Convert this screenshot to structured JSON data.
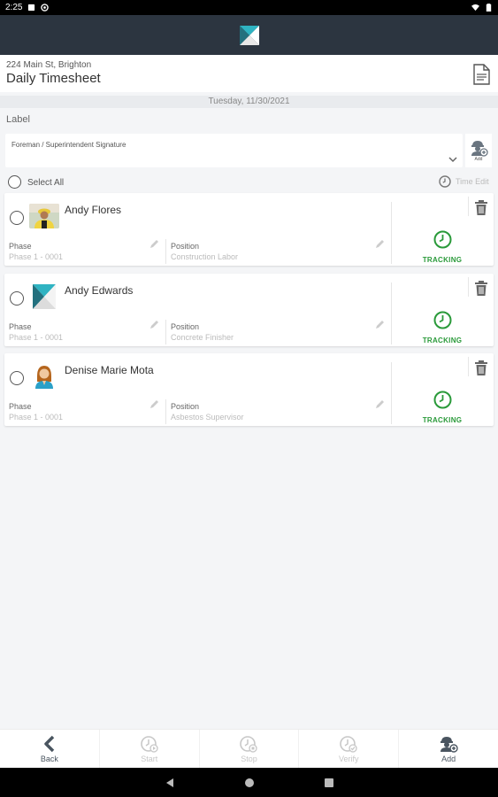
{
  "status_bar": {
    "time": "2:25"
  },
  "header": {
    "address": "224 Main St, Brighton",
    "title": "Daily Timesheet"
  },
  "date": "Tuesday, 11/30/2021",
  "label": "Label",
  "signature": {
    "label": "Foreman / Superintendent Signature",
    "add_label": "Add"
  },
  "select_all": {
    "label": "Select All"
  },
  "time_edit": {
    "label": "Time Edit"
  },
  "employees": [
    {
      "name": "Andy Flores",
      "phase_label": "Phase",
      "phase_value": "Phase 1 - 0001",
      "position_label": "Position",
      "position_value": "Construction Labor",
      "status": "TRACKING"
    },
    {
      "name": "Andy Edwards",
      "phase_label": "Phase",
      "phase_value": "Phase 1 - 0001",
      "position_label": "Position",
      "position_value": "Concrete Finisher",
      "status": "TRACKING"
    },
    {
      "name": "Denise Marie Mota",
      "phase_label": "Phase",
      "phase_value": "Phase 1 - 0001",
      "position_label": "Position",
      "position_value": "Asbestos Supervisor",
      "status": "TRACKING"
    }
  ],
  "bottom_nav": [
    {
      "label": "Back",
      "icon": "back-arrow-icon",
      "enabled": true
    },
    {
      "label": "Start",
      "icon": "clock-start-icon",
      "enabled": false
    },
    {
      "label": "Stop",
      "icon": "clock-stop-icon",
      "enabled": false
    },
    {
      "label": "Verify",
      "icon": "clock-verify-icon",
      "enabled": false
    },
    {
      "label": "Add",
      "icon": "add-worker-icon",
      "enabled": true
    }
  ],
  "colors": {
    "app_bar": "#2c3540",
    "tracking_green": "#2a9a3a",
    "background": "#f4f5f7"
  }
}
